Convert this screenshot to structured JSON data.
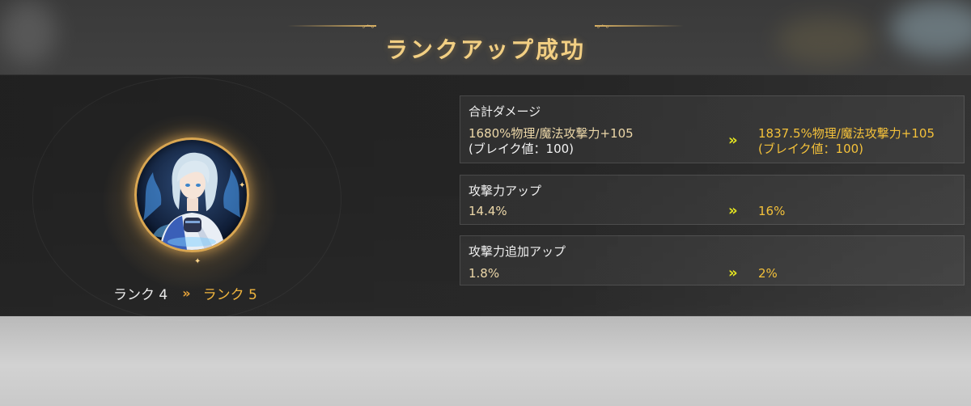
{
  "title": "ランクアップ成功",
  "rank": {
    "from": "ランク 4",
    "to": "ランク 5",
    "arrow": "»"
  },
  "stats": [
    {
      "name": "合計ダメージ",
      "old_line1": "1680%物理/魔法攻撃力+105",
      "old_line2": "(ブレイク値：100)",
      "new_line1": "1837.5%物理/魔法攻撃力+105",
      "new_line2": "(ブレイク値：100)",
      "arrow": "»"
    },
    {
      "name": "攻撃力アップ",
      "old": "14.4%",
      "new": "16%",
      "arrow": "»"
    },
    {
      "name": "攻撃力追加アップ",
      "old": "1.8%",
      "new": "2%",
      "arrow": "»"
    }
  ],
  "colors": {
    "accent_gold": "#f0b53e",
    "arrow_yellow": "#e3e321",
    "title_gold": "#f2cf83"
  }
}
